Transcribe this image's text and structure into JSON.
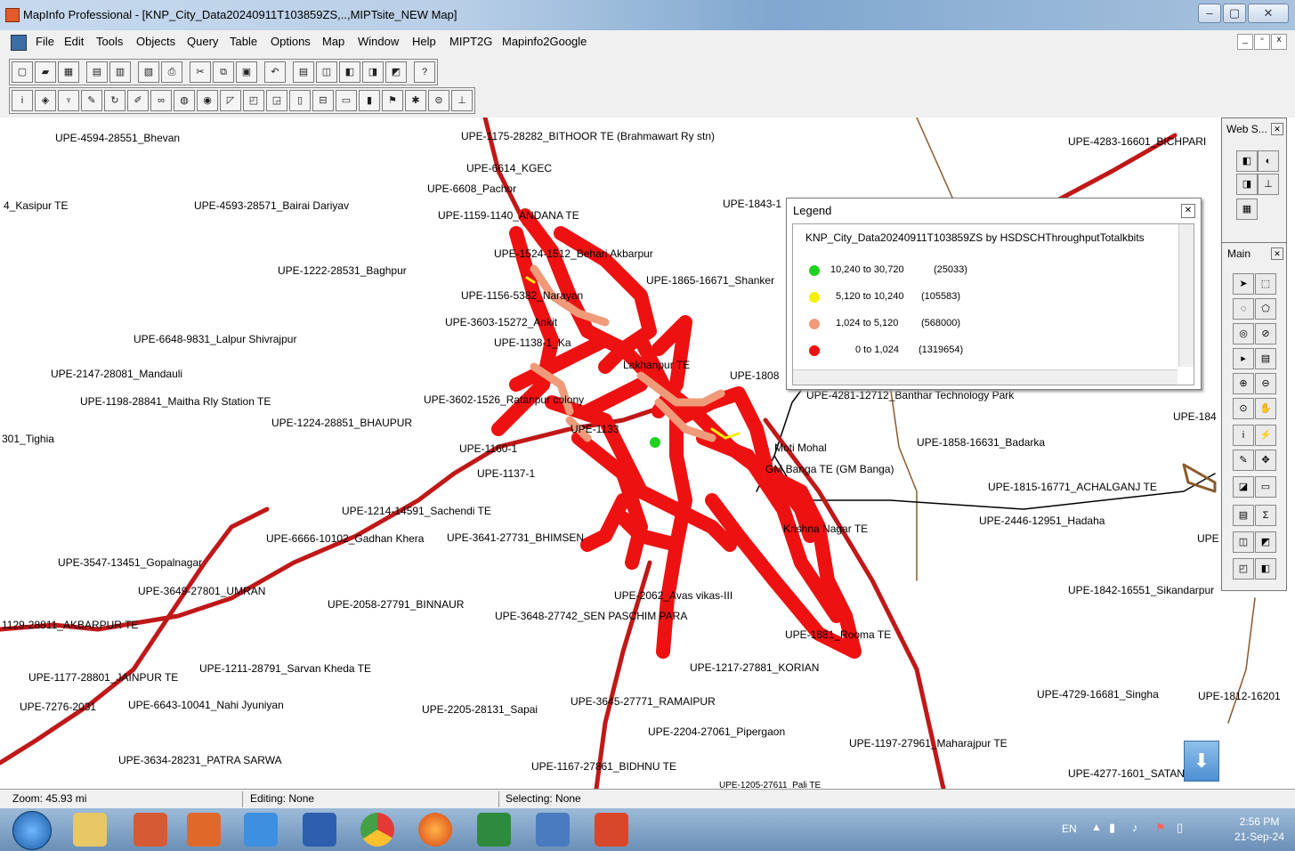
{
  "window": {
    "title": "MapInfo Professional - [KNP_City_Data20240911T103859ZS,..,MIPTsite_NEW Map]",
    "controls": [
      "–",
      "▢",
      "✕"
    ]
  },
  "menubar": {
    "items": [
      "File",
      "Edit",
      "Tools",
      "Objects",
      "Query",
      "Table",
      "Options",
      "Map",
      "Window",
      "Help",
      "MIPT2G",
      "Mapinfo2Google"
    ]
  },
  "legend": {
    "title": "Legend",
    "heading": "KNP_City_Data20240911T103859ZS by HSDSCHThroughputTotalkbits",
    "rows": [
      {
        "range": "10,240 to 30,720",
        "count": "(25033)",
        "color": "#1fd11f"
      },
      {
        "range": "5,120 to 10,240",
        "count": "(105583)",
        "color": "#f5f000"
      },
      {
        "range": "1,024 to  5,120",
        "count": "(568000)",
        "color": "#f09a7a"
      },
      {
        "range": "0 to  1,024",
        "count": "(1319654)",
        "color": "#ee1111"
      }
    ]
  },
  "palettes": {
    "web": {
      "title": "Web S..."
    },
    "main": {
      "title": "Main"
    }
  },
  "map_labels": [
    "UPE-4594-28551_Bhevan",
    "UPE-1175-28282_BITHOOR TE (Brahmawart Ry stn)",
    "UPE-4283-16601_BICHPARI",
    "UPE-6614_KGEC",
    "UPE-6608_Pachor",
    "4_Kasipur TE",
    "UPE-4593-28571_Bairai Dariyav",
    "UPE-1159-1140_ANDANA TE",
    "UPE-1843-1",
    "UPE-1222-28531_Baghpur",
    "UPE-1524-1512_Behari Akbarpur",
    "UPE-1865-16671_Shanker",
    "UPE-1156-5382_Narayan",
    "UPE-3603-15272_Ankit",
    "UPE-6648-9831_Lalpur Shivrajpur",
    "UPE-1138-1_Ka",
    "UPE-2147-28081_Mandauli",
    "Lakhanpur TE",
    "UPE-1808",
    "UPE-1198-28841_Maitha Rly Station TE",
    "UPE-3602-1526_Ratanpur colony",
    "UPE-4281-12712_Banthar Technology Park",
    "UPE-1224-28851_BHAUPUR",
    "UPE-1133",
    "UPE-184",
    "301_Tighia",
    "UPE-1858-16631_Badarka",
    "UPE-1160-1",
    "Moti Mohal",
    "UPE-1137-1",
    "GM Banga TE (GM Banga)",
    "UPE-1815-16771_ACHALGANJ TE",
    "UPE-1214-14591_Sachendi TE",
    "UPE-2446-12951_Hadaha",
    "UPE-6666-10102_Gadhan Khera",
    "UPE-3641-27731_BHIMSEN",
    "Krishna Nagar TE",
    "UPE",
    "UPE-3547-13451_Gopalnagar",
    "UPE-3649-27801_UMRAN",
    "UPE-1842-16551_Sikandarpur",
    "UPE-2058-27791_BINNAUR",
    "UPE-2062_Avas vikas-III",
    "UPE-3648-27742_SEN PASCHIM PARA",
    "1129-28811_AKBARPUR TE",
    "UPE-1881_Rooma TE",
    "UPE-1177-28801_JAINPUR TE",
    "UPE-1211-28791_Sarvan Kheda TE",
    "UPE-1217-27881_KORIAN",
    "UPE-4729-16681_Singha",
    "UPE-1812-16201",
    "UPE-7276-2031",
    "UPE-6643-10041_Nahi Jyuniyan",
    "UPE-2205-28131_Sapai",
    "UPE-3645-27771_RAMAIPUR",
    "UPE-2204-27061_Pipergaon",
    "UPE-1197-27961_Maharajpur TE",
    "UPE-3634-28231_PATRA SARWA",
    "UPE-1167-27861_BIDHNU TE",
    "UPE-4277-1601_SATAN",
    "UPE-1205-27611_Pali TE"
  ],
  "statusbar": {
    "zoom": "Zoom: 45.93 mi",
    "editing": "Editing: None",
    "selecting": "Selecting: None"
  },
  "taskbar": {
    "language": "EN",
    "time": "2:56 PM",
    "date": "21-Sep-24"
  }
}
